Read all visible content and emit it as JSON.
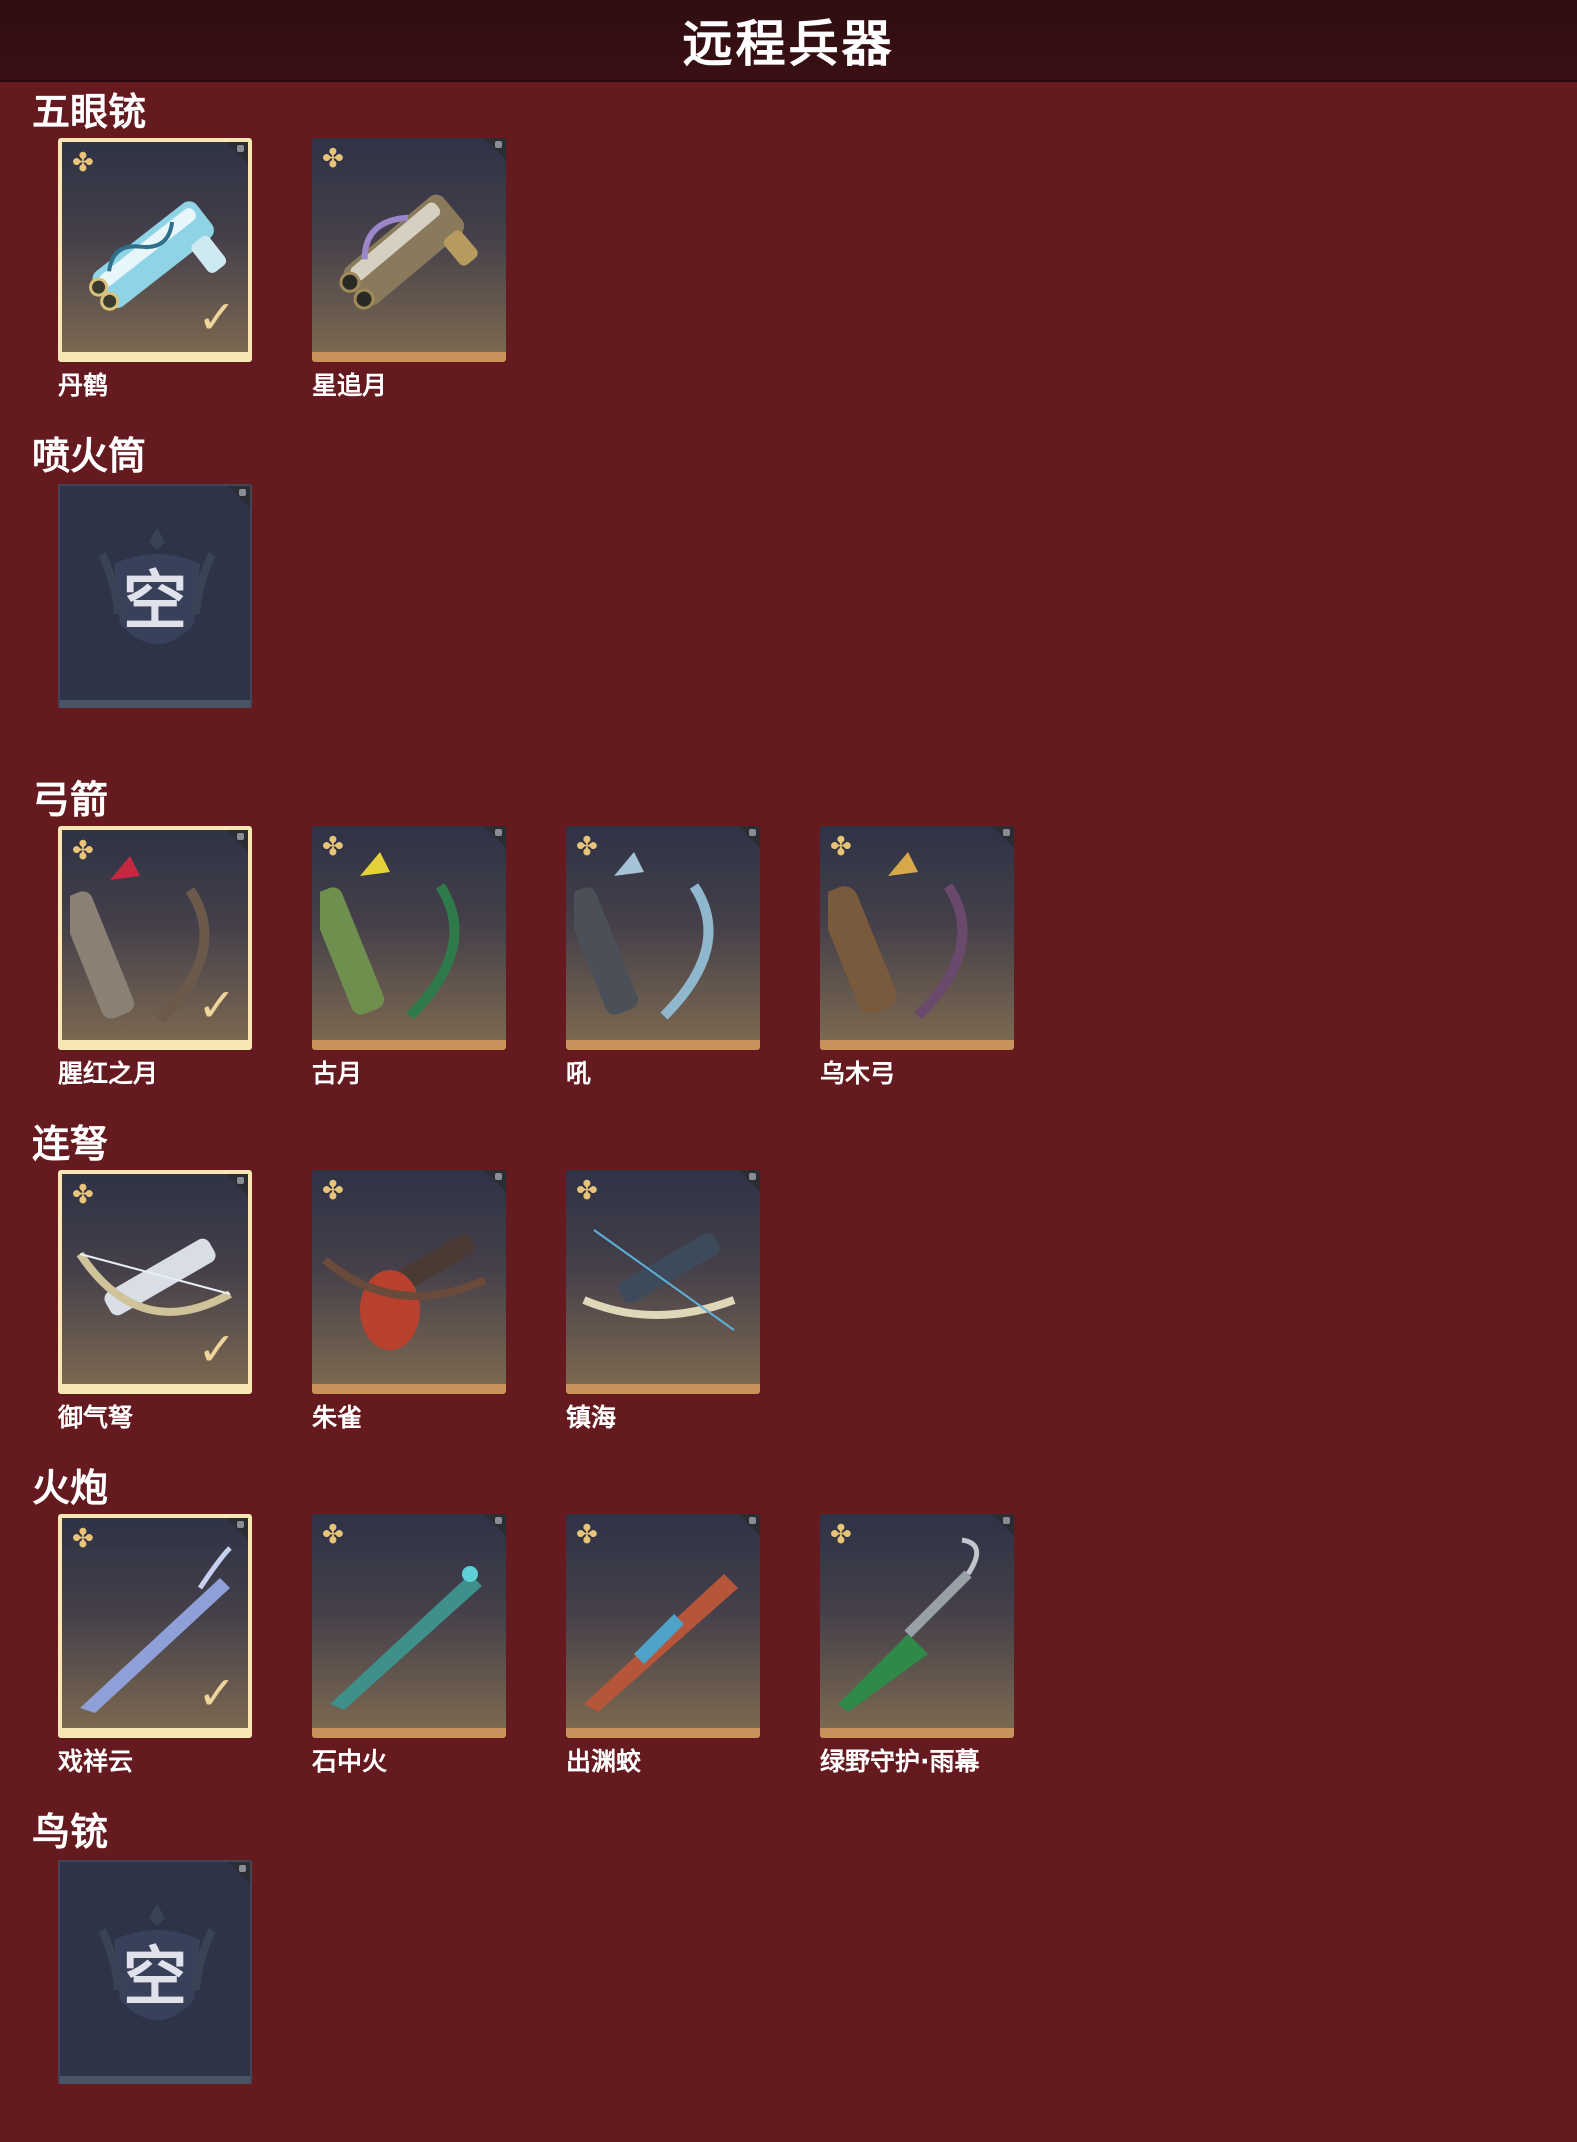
{
  "header": {
    "title": "远程兵器"
  },
  "icons": {
    "favorite": "favorite-emblem-icon",
    "equipped": "equipped-check-icon"
  },
  "colors": {
    "background": "#651a1f",
    "header": "#2e0d10",
    "equipped_border": "#f7e7b5",
    "card_bottom": "#c7935a",
    "empty_card": "#2e3447"
  },
  "sections": [
    {
      "title": "五眼铳",
      "items": [
        {
          "label": "丹鹤",
          "equipped": true,
          "empty": false
        },
        {
          "label": "星追月",
          "equipped": false,
          "empty": false
        }
      ]
    },
    {
      "title": "喷火筒",
      "items": [
        {
          "label": "",
          "equipped": false,
          "empty": true,
          "empty_text": "空"
        }
      ]
    },
    {
      "title": "弓箭",
      "items": [
        {
          "label": "腥红之月",
          "equipped": true,
          "empty": false
        },
        {
          "label": "古月",
          "equipped": false,
          "empty": false
        },
        {
          "label": "吼",
          "equipped": false,
          "empty": false
        },
        {
          "label": "乌木弓",
          "equipped": false,
          "empty": false
        }
      ]
    },
    {
      "title": "连弩",
      "items": [
        {
          "label": "御气弩",
          "equipped": true,
          "empty": false
        },
        {
          "label": "朱雀",
          "equipped": false,
          "empty": false
        },
        {
          "label": "镇海",
          "equipped": false,
          "empty": false
        }
      ]
    },
    {
      "title": "火炮",
      "items": [
        {
          "label": "戏祥云",
          "equipped": true,
          "empty": false
        },
        {
          "label": "石中火",
          "equipped": false,
          "empty": false
        },
        {
          "label": "出渊蛟",
          "equipped": false,
          "empty": false
        },
        {
          "label": "绿野守护·雨幕",
          "equipped": false,
          "empty": false
        }
      ]
    },
    {
      "title": "鸟铳",
      "items": [
        {
          "label": "",
          "equipped": false,
          "empty": true,
          "empty_text": "空"
        }
      ]
    }
  ]
}
